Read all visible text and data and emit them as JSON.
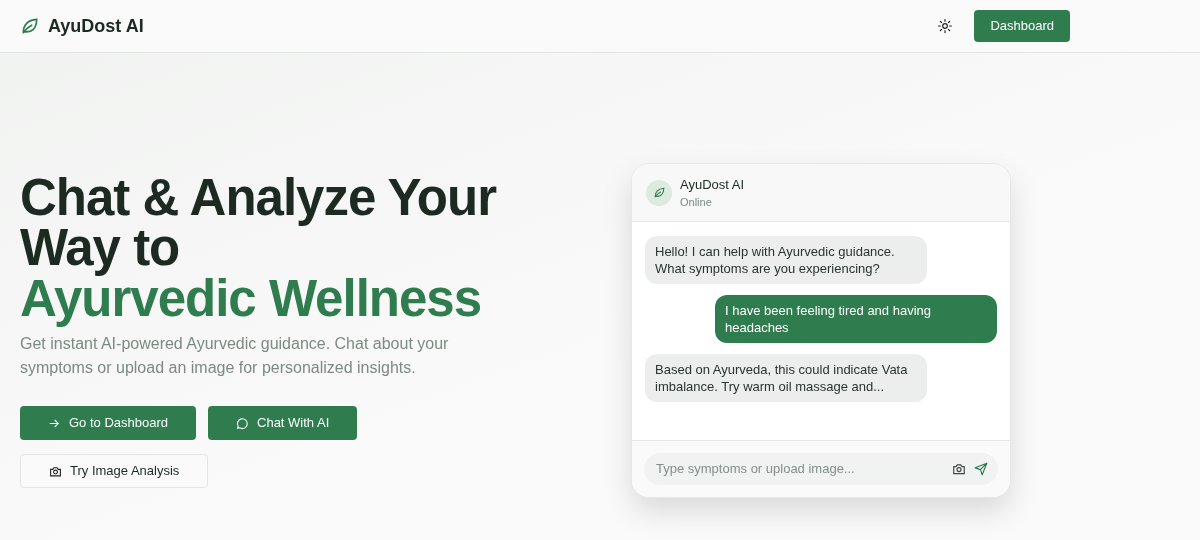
{
  "navbar": {
    "brand": "AyuDost AI",
    "dashboard_button": "Dashboard"
  },
  "hero": {
    "title_line_1": "Chat & Analyze Your",
    "title_line_2": "Way to",
    "title_highlight": "Ayurvedic Wellness",
    "subtitle": "Get instant AI-powered Ayurvedic guidance. Chat about your symptoms or upload an image for personalized insights.",
    "buttons": [
      {
        "label": "Go to Dashboard",
        "kind": "primary"
      },
      {
        "label": "Chat With AI",
        "kind": "primary"
      },
      {
        "label": "Try Image Analysis",
        "kind": "outline"
      }
    ]
  },
  "chat": {
    "name": "AyuDost AI",
    "status": "Online",
    "messages": [
      {
        "kind": "bot",
        "text": "Hello! I can help with Ayurvedic guidance. What symptoms are you experiencing?"
      },
      {
        "kind": "user",
        "text": "I have been feeling tired and having headaches"
      },
      {
        "kind": "bot",
        "text": "Based on Ayurveda, this could indicate Vata imbalance. Try warm oil massage and..."
      }
    ],
    "input": {
      "placeholder": "Type symptoms or upload image..."
    }
  }
}
